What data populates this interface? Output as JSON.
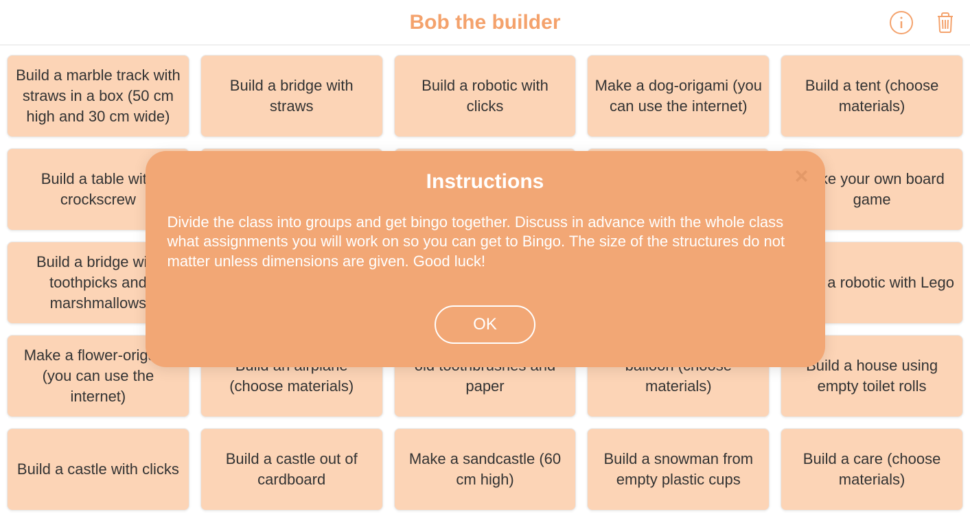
{
  "header": {
    "title": "Bob the builder"
  },
  "cards": [
    "Build a marble track with straws in a box (50 cm high and 30 cm wide)",
    "Build a bridge with straws",
    "Build a robotic with clicks",
    "Make a dog-origami (you can use the internet)",
    "Build a tent (choose materials)",
    "Build a table with crockscrew",
    "",
    "",
    "",
    "Make your own board game",
    "Build a bridge with toothpicks and marshmallows",
    "",
    "",
    "",
    "Build a robotic with Lego",
    "Make a flower-origami (you can use the internet)",
    "Build an airplane (choose materials)",
    "old toothbrushes and paper",
    "balloon (choose materials)",
    "Build a house using empty toilet rolls",
    "Build a castle with clicks",
    "Build a castle out of cardboard",
    "Make a sandcastle (60 cm high)",
    "Build a snowman from empty plastic cups",
    "Build a care (choose materials)"
  ],
  "modal": {
    "title": "Instructions",
    "body": "Divide the class into groups and get bingo together. Discuss in advance with the whole class what assignments you will work on so you can get to Bingo. The size of the structures do not matter unless dimensions are given. Good luck!",
    "ok_label": "OK",
    "close_label": "×"
  }
}
